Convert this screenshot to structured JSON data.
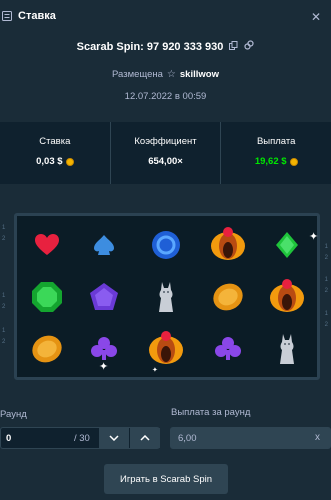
{
  "header": {
    "title": "Ставка",
    "icon": "bet-slip-icon",
    "close_icon": "close-icon"
  },
  "bet": {
    "id_label": "Scarab Spin: 97 920 333 930",
    "placed_label": "Размещена",
    "username": "skillwow",
    "date": "12.07.2022 в 00:59"
  },
  "stats": {
    "stake_label": "Ставка",
    "stake_value": "0,03 $",
    "multiplier_label": "Коэффициент",
    "multiplier_value": "654,00×",
    "payout_label": "Выплата",
    "payout_value": "19,62 $"
  },
  "reels": [
    [
      "heart",
      "spade",
      "ring",
      "scarab",
      "diamond"
    ],
    [
      "emerald",
      "pentagon",
      "cat",
      "coin",
      "scarab"
    ],
    [
      "coin",
      "club",
      "scarab",
      "club",
      "cat"
    ]
  ],
  "row_numbers_left": [
    "1",
    "2",
    "1",
    "2",
    "1",
    "2"
  ],
  "row_numbers_right": [
    "1",
    "2",
    "1",
    "2",
    "1",
    "2"
  ],
  "controls": {
    "round_label": "Раунд",
    "round_value": "0",
    "round_max": "/ 30",
    "payout_round_label": "Выплата за раунд",
    "payout_round_value": "6,00",
    "clear_symbol": "x"
  },
  "play_button": "Играть в Scarab Spin",
  "colors": {
    "background": "#1a2c38",
    "panel": "#0f212e",
    "border": "#2f4553",
    "muted_text": "#b1bad3",
    "green": "#00e701",
    "coin": "#f5b400"
  }
}
